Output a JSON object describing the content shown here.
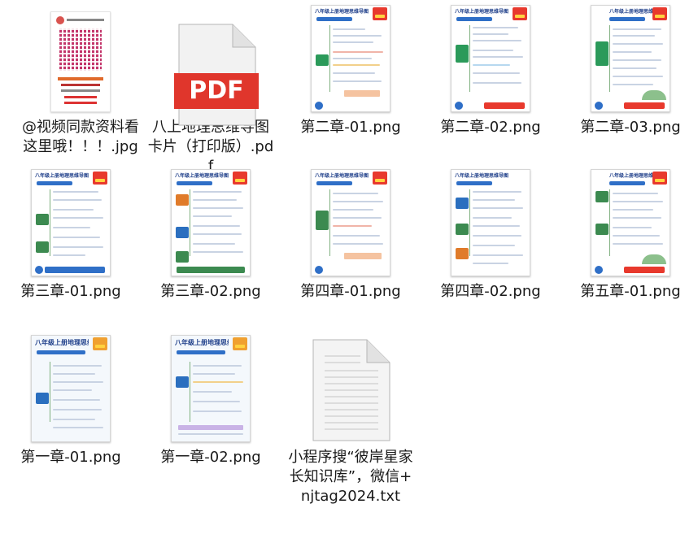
{
  "files": [
    {
      "name": "@视频同款资料看这里哦！！！.jpg",
      "thumb": "qr-image"
    },
    {
      "name": "八上地理思维导图卡片（打印版）.pdf",
      "thumb": "pdf",
      "badge": "PDF"
    },
    {
      "name": "第二章-01.png",
      "thumb": "poster",
      "heading": "八年级上册地理思维导图",
      "accent": "#2b9a5a"
    },
    {
      "name": "第二章-02.png",
      "thumb": "poster",
      "heading": "八年级上册地理思维导图",
      "accent": "#2b9a5a"
    },
    {
      "name": "第二章-03.png",
      "thumb": "poster",
      "heading": "八年级上册地理思维导图",
      "accent": "#2b9a5a"
    },
    {
      "name": "第三章-01.png",
      "thumb": "poster",
      "heading": "八年级上册地理思维导图",
      "accent": "#3c8a50"
    },
    {
      "name": "第三章-02.png",
      "thumb": "poster",
      "heading": "八年级上册地理思维导图",
      "accent": "#e07b2a"
    },
    {
      "name": "第四章-01.png",
      "thumb": "poster",
      "heading": "八年级上册地理思维导图",
      "accent": "#3c8a50"
    },
    {
      "name": "第四章-02.png",
      "thumb": "poster",
      "heading": "八年级上册地理思维导图",
      "accent": "#2b6fbf"
    },
    {
      "name": "第五章-01.png",
      "thumb": "poster",
      "heading": "八年级上册地理思维导图",
      "accent": "#3c8a50"
    },
    {
      "name": "第一章-01.png",
      "thumb": "poster",
      "heading": "八年级上册地理思维导图",
      "accent": "#2b6fbf"
    },
    {
      "name": "第一章-02.png",
      "thumb": "poster",
      "heading": "八年级上册地理思维导图",
      "accent": "#2b6fbf"
    },
    {
      "name": "小程序搜“彼岸星家长知识库”，微信+njtag2024.txt",
      "thumb": "text"
    }
  ],
  "colors": {
    "pdf_red": "#e0362c",
    "poster_blue": "#2f6fc7"
  }
}
